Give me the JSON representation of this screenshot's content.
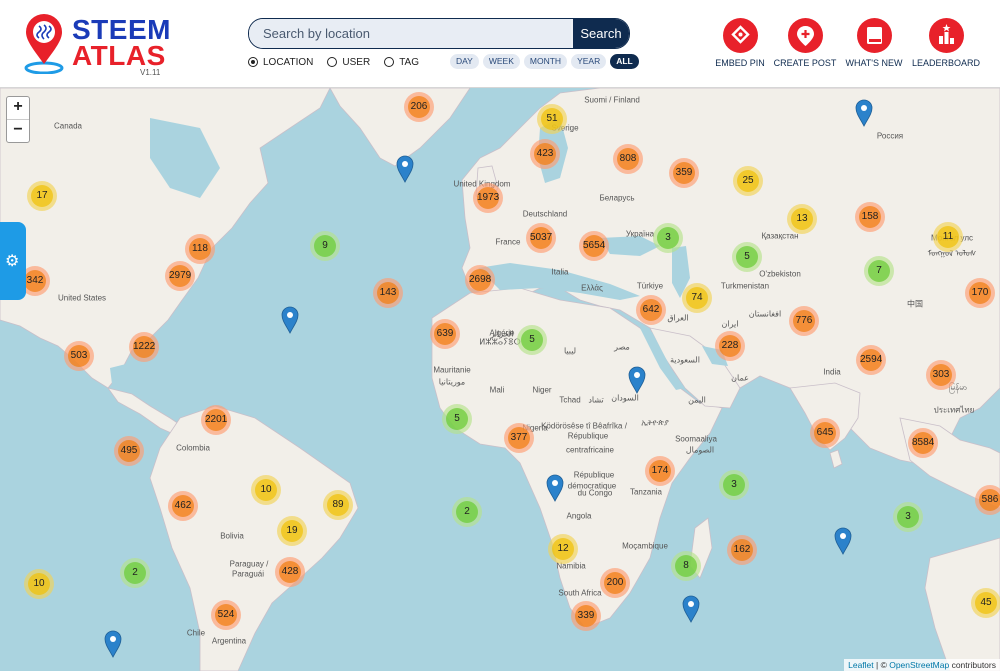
{
  "brand": {
    "line1": "STEEM",
    "line2": "ATLAS",
    "version": "V1.11"
  },
  "search": {
    "placeholder": "Search by location",
    "button": "Search"
  },
  "search_modes": [
    {
      "label": "LOCATION",
      "selected": true
    },
    {
      "label": "USER",
      "selected": false
    },
    {
      "label": "TAG",
      "selected": false
    }
  ],
  "periods": [
    {
      "label": "DAY",
      "active": false
    },
    {
      "label": "WEEK",
      "active": false
    },
    {
      "label": "MONTH",
      "active": false
    },
    {
      "label": "YEAR",
      "active": false
    },
    {
      "label": "ALL",
      "active": true
    }
  ],
  "actions": [
    {
      "label": "EMBED PIN",
      "icon": "embed-pin-icon"
    },
    {
      "label": "CREATE POST",
      "icon": "create-post-icon"
    },
    {
      "label": "WHAT'S NEW",
      "icon": "book-icon"
    },
    {
      "label": "LEADERBOARD",
      "icon": "leaderboard-icon"
    }
  ],
  "zoom": {
    "in": "+",
    "out": "−"
  },
  "colors": {
    "accent": "#e8212a",
    "navy": "#0f2b4f",
    "water": "#aad3df",
    "land": "#f2efe9",
    "tab": "#1e9be6"
  },
  "attribution": {
    "leaflet": "Leaflet",
    "sep": " | © ",
    "osm": "OpenStreetMap",
    "suffix": " contributors"
  },
  "place_labels": [
    "Canada",
    "United States",
    "Suomi / Finland",
    "Sverige",
    "United Kingdom",
    "Deutschland",
    "France",
    "Italia",
    "Ελλάς",
    "Беларусь",
    "Україна",
    "Россия",
    "Қазақстан",
    "O'zbekiston",
    "Türkiye",
    "Turkmenistan",
    "العراق",
    "ایران",
    "افغانستان",
    "السعودية",
    "عمان",
    "مصر",
    "ليبيا",
    "الجزائر",
    "Algérie",
    "ⵍⵣⵣⴰⵢⴻⵔ",
    "Mauritanie",
    "موريتانيا",
    "Mali",
    "Niger",
    "Tchad",
    "تشاد",
    "السودان",
    "ኢትዮጵያ",
    "اليمن",
    "Soomaaliya",
    "الصومال",
    "Nigeria",
    "Ködörösêse tî Bêafrîka /",
    "République",
    "centrafricaine",
    "République",
    "démocratique",
    "du Congo",
    "Tanzania",
    "Angola",
    "Moçambique",
    "Namibia",
    "South Africa",
    "Colombia",
    "Bolivia",
    "Paraguay /",
    "Paraguái",
    "Chile",
    "Argentina",
    "India",
    "中国",
    "Монгол улс",
    "ᠮᠣᠩᠭᠣᠯ ᠤᠯᠤᠰ",
    "မြန်မာ",
    "ประเทศไทย"
  ],
  "clusters": [
    {
      "n": 206,
      "tier": "large"
    },
    {
      "n": 51,
      "tier": "medium"
    },
    {
      "n": 423,
      "tier": "large"
    },
    {
      "n": 808,
      "tier": "large"
    },
    {
      "n": 359,
      "tier": "large"
    },
    {
      "n": 25,
      "tier": "medium"
    },
    {
      "n": 17,
      "tier": "medium"
    },
    {
      "n": 1973,
      "tier": "large"
    },
    {
      "n": 13,
      "tier": "medium"
    },
    {
      "n": 158,
      "tier": "large"
    },
    {
      "n": 11,
      "tier": "medium"
    },
    {
      "n": 118,
      "tier": "large"
    },
    {
      "n": 9,
      "tier": "small"
    },
    {
      "n": 5037,
      "tier": "large"
    },
    {
      "n": 5654,
      "tier": "large"
    },
    {
      "n": 3,
      "tier": "small"
    },
    {
      "n": 5,
      "tier": "small"
    },
    {
      "n": 7,
      "tier": "small"
    },
    {
      "n": 342,
      "tier": "large"
    },
    {
      "n": 2979,
      "tier": "large"
    },
    {
      "n": 2698,
      "tier": "large"
    },
    {
      "n": 143,
      "tier": "large"
    },
    {
      "n": 74,
      "tier": "medium"
    },
    {
      "n": 170,
      "tier": "large"
    },
    {
      "n": 642,
      "tier": "large"
    },
    {
      "n": 776,
      "tier": "large"
    },
    {
      "n": 639,
      "tier": "large"
    },
    {
      "n": 5,
      "tier": "small"
    },
    {
      "n": 1222,
      "tier": "large"
    },
    {
      "n": 503,
      "tier": "large"
    },
    {
      "n": 228,
      "tier": "large"
    },
    {
      "n": 2594,
      "tier": "large"
    },
    {
      "n": 303,
      "tier": "large"
    },
    {
      "n": 2201,
      "tier": "large"
    },
    {
      "n": 5,
      "tier": "small"
    },
    {
      "n": 377,
      "tier": "large"
    },
    {
      "n": 645,
      "tier": "large"
    },
    {
      "n": 8584,
      "tier": "large"
    },
    {
      "n": 495,
      "tier": "large"
    },
    {
      "n": 174,
      "tier": "large"
    },
    {
      "n": 10,
      "tier": "medium"
    },
    {
      "n": 89,
      "tier": "medium"
    },
    {
      "n": 462,
      "tier": "large"
    },
    {
      "n": 3,
      "tier": "small"
    },
    {
      "n": 2,
      "tier": "small"
    },
    {
      "n": 19,
      "tier": "medium"
    },
    {
      "n": 586,
      "tier": "large"
    },
    {
      "n": 3,
      "tier": "small"
    },
    {
      "n": 12,
      "tier": "medium"
    },
    {
      "n": 162,
      "tier": "large"
    },
    {
      "n": 2,
      "tier": "small"
    },
    {
      "n": 8,
      "tier": "small"
    },
    {
      "n": 10,
      "tier": "medium"
    },
    {
      "n": 428,
      "tier": "large"
    },
    {
      "n": 200,
      "tier": "large"
    },
    {
      "n": 524,
      "tier": "large"
    },
    {
      "n": 339,
      "tier": "large"
    },
    {
      "n": 45,
      "tier": "medium"
    }
  ]
}
